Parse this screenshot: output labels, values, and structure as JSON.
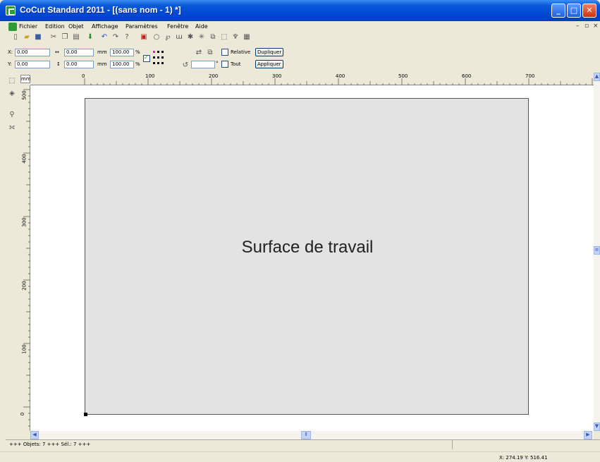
{
  "window": {
    "title": "CoCut Standard 2011 - [(sans nom - 1) *]"
  },
  "menu": [
    "Fichier",
    "Edition",
    "Objet",
    "Affichage",
    "Paramètres",
    "Fenêtre",
    "Aide"
  ],
  "props": {
    "x_label": "X:",
    "x_value": "0.00",
    "y_label": "Y:",
    "y_value": "0.00",
    "w_value": "0.00",
    "h_value": "0.00",
    "unit1": "mm",
    "unit2": "mm",
    "scale_w": "100.00",
    "scale_h": "100.00",
    "pct1": "%",
    "pct2": "%",
    "relative_label": "Relative",
    "dupliquer_label": "Dupliquer",
    "deg_label": "°",
    "tout_label": "Tout",
    "appliquer_label": "Appliquer"
  },
  "ruler": {
    "unit": "mm",
    "h_labels": [
      "0",
      "100",
      "200",
      "300",
      "400",
      "500",
      "600",
      "700"
    ],
    "v_labels": [
      "500",
      "400",
      "300",
      "200",
      "100",
      "0"
    ]
  },
  "canvas": {
    "label": "Surface de travail"
  },
  "status": {
    "objects": "+++ Objets: 7 +++ Sél.: 7 +++",
    "coords": "X: 274.19 Y: 516.41"
  },
  "colors": {
    "title_bar": "#0a4fd5",
    "work_surface": "#e3e3e3",
    "canvas": "#ffffff",
    "chrome": "#ece9d8"
  }
}
